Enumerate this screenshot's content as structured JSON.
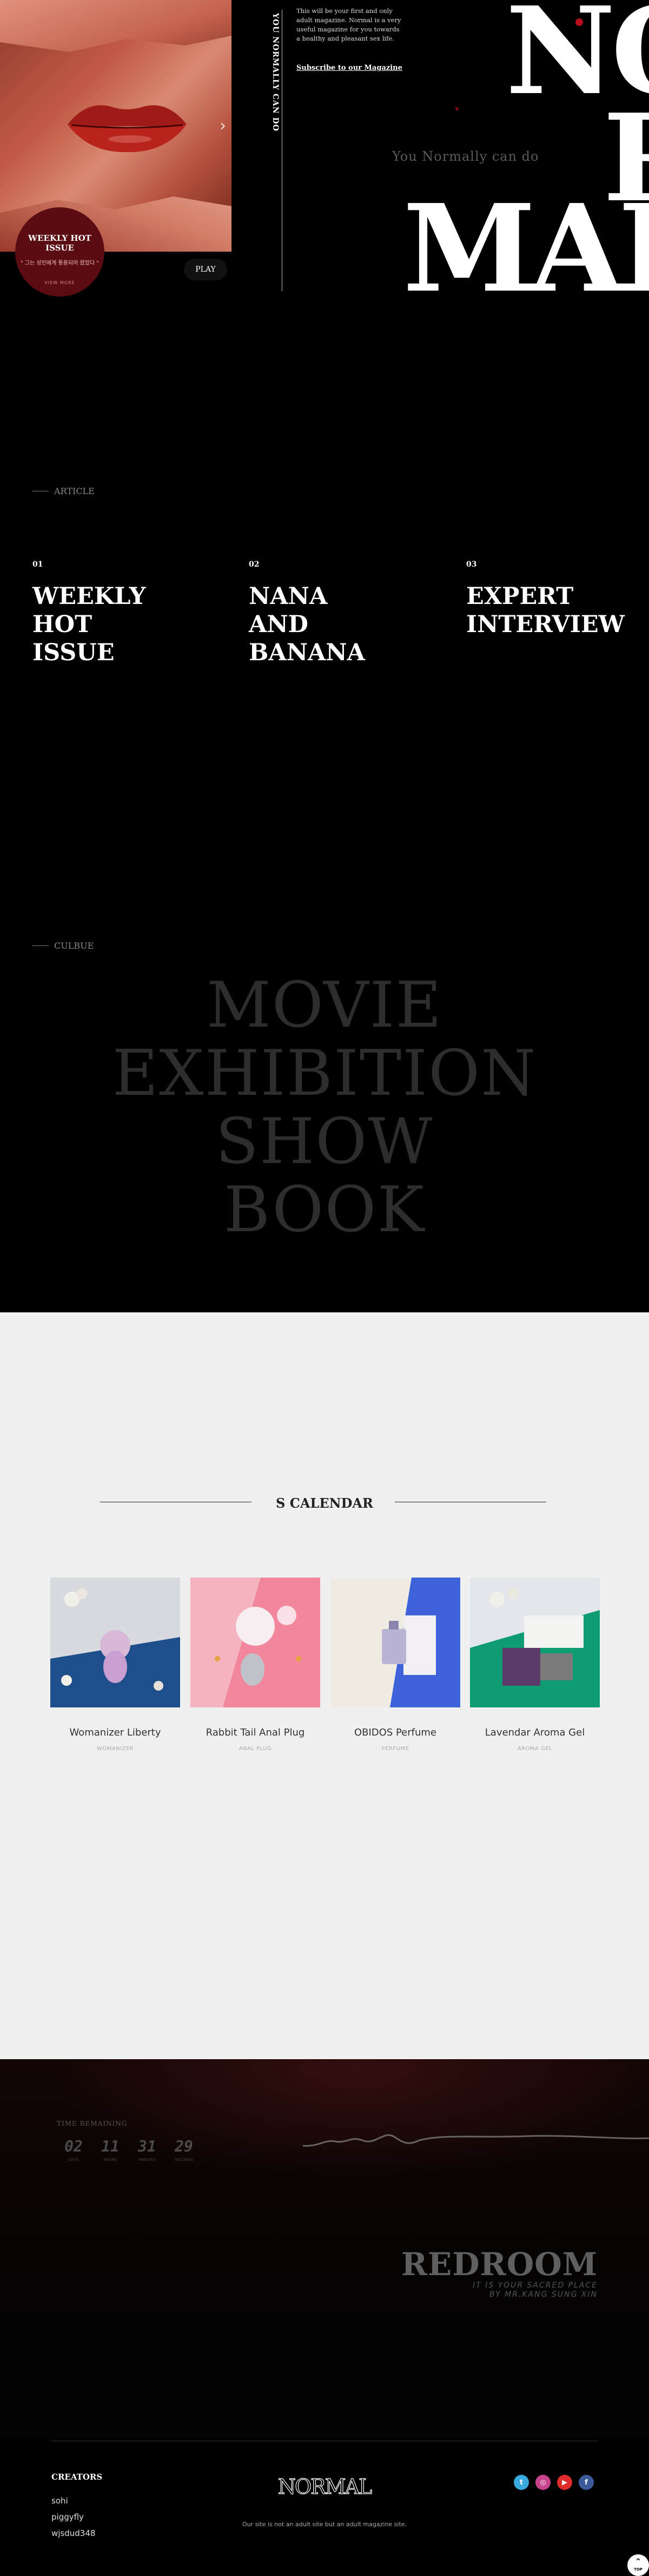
{
  "hero": {
    "issue_title": "WEEKLY HOT ISSUE",
    "issue_subtitle": "\" 그는 성인에게 통용되어 왔었다 \"",
    "issue_more": "VIEW MORE",
    "play_label": "PLAY",
    "vertical_tagline": "YOU NORMALLY CAN DO",
    "intro_text": "This will be your first and only adult magazine. Normal is a very useful magazine for you towards a healthy and pleasant sex life.",
    "subscribe_label": "Subscribe to our Magazine",
    "tagline": "You Normally can do",
    "logo_line1": "NO",
    "logo_line2": "R",
    "logo_line3": "MAL",
    "arrow_icon": "chevron-right-icon"
  },
  "article": {
    "section_label": "ARTICLE",
    "items": [
      {
        "num": "01",
        "title": "WEEKLY\nHOT\nISSUE"
      },
      {
        "num": "02",
        "title": "NANA\nAND\nBANANA"
      },
      {
        "num": "03",
        "title": "EXPERT\nINTERVIEW"
      }
    ]
  },
  "culture": {
    "section_label": "CULBUE",
    "words": [
      "MOVIE",
      "EXHIBITION",
      "SHOW",
      "BOOK"
    ]
  },
  "calendar": {
    "title": "S CALENDAR",
    "products": [
      {
        "name": "Womanizer Liberty",
        "category": "WOMANIZER"
      },
      {
        "name": "Rabbit Tail Anal Plug",
        "category": "ANAL PLUG"
      },
      {
        "name": "OBIDOS Perfume",
        "category": "PERFUME"
      },
      {
        "name": "Lavendar Aroma Gel",
        "category": "AROMA GEL"
      }
    ]
  },
  "redroom": {
    "time_label": "TIME REMAINING",
    "countdown": [
      {
        "value": "02",
        "unit": "DAYS"
      },
      {
        "value": "11",
        "unit": "HOURS"
      },
      {
        "value": "31",
        "unit": "MINUTES"
      },
      {
        "value": "29",
        "unit": "SECONDS"
      }
    ],
    "title": "REDROOM",
    "subtitle1": "IT IS YOUR SACRED PLACE",
    "subtitle2": "BY MR.KANG SUNG XIN"
  },
  "footer": {
    "creators_title": "CREATORS",
    "creators": [
      "sohi",
      "piggyfly",
      "wjsdud348"
    ],
    "logo_text": "NORMAL",
    "note": "Our site is not an adult site but an adult magazine site.",
    "social": [
      {
        "icon": "twitter-icon",
        "glyph": "t",
        "color": "#3aa9df"
      },
      {
        "icon": "instagram-icon",
        "glyph": "◎",
        "color": "#c9438c"
      },
      {
        "icon": "youtube-icon",
        "glyph": "▶",
        "color": "#e02b2b"
      },
      {
        "icon": "facebook-icon",
        "glyph": "f",
        "color": "#3b5998"
      }
    ],
    "top_label": "TOP"
  }
}
